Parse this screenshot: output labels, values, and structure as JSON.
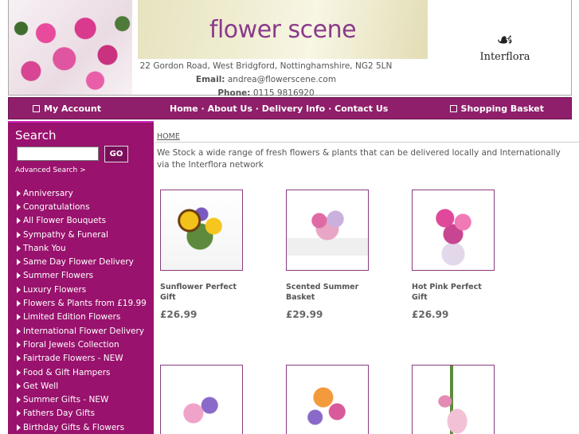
{
  "header": {
    "banner_title": "flower scene",
    "address": "22 Gordon Road, West Bridgford, Nottinghamshire, NG2 5LN",
    "email_label": "Email:",
    "email": "andrea@flowerscene.com",
    "phone_label": "Phone:",
    "phone": "0115 9816920",
    "partner_logo": "Interflora"
  },
  "nav": {
    "account": "My Account",
    "links": [
      "Home",
      "About Us",
      "Delivery Info",
      "Contact Us"
    ],
    "separator": "·",
    "basket": "Shopping Basket"
  },
  "sidebar": {
    "search_title": "Search",
    "search_value": "",
    "go_label": "GO",
    "advanced_search": "Advanced Search >",
    "categories": [
      "Anniversary",
      "Congratulations",
      "All Flower Bouquets",
      "Sympathy & Funeral",
      "Thank You",
      "Same Day Flower Delivery",
      "Summer Flowers",
      "Luxury Flowers",
      "Flowers & Plants from £19.99",
      "Limited Edition Flowers",
      "International Flower Delivery",
      "Floral Jewels Collection",
      "Fairtrade Flowers - NEW",
      "Food & Gift Hampers",
      "Get Well",
      "Summer Gifts - NEW",
      "Fathers Day Gifts",
      "Birthday Gifts & Flowers"
    ]
  },
  "main": {
    "breadcrumb": "HOME",
    "intro": "We Stock a wide range of fresh flowers & plants that can be delivered locally and Internationally via the Interflora network",
    "products": [
      {
        "name": "Sunflower Perfect Gift",
        "price": "£26.99"
      },
      {
        "name": "Scented Summer Basket",
        "price": "£29.99"
      },
      {
        "name": "Hot Pink Perfect Gift",
        "price": "£26.99"
      }
    ]
  },
  "colors": {
    "brand_purple": "#8f1f6a",
    "sidebar_bg": "#99126d",
    "banner_text": "#8a3a8c"
  }
}
